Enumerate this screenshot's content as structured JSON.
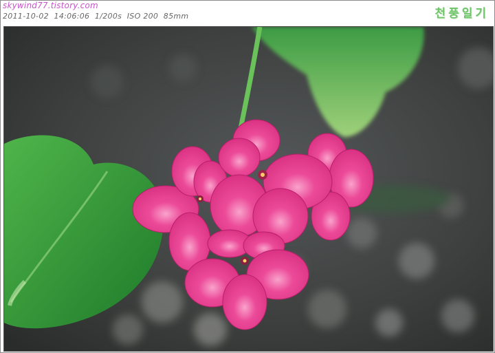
{
  "header": {
    "site_url": "skywind77.tistory.com",
    "exif_line": "2011-10-02  14:06:06  1/200s  ISO 200  85mm",
    "blog_title": "천풍일기"
  },
  "photo": {
    "subject": "pink-geranium-flower",
    "colors": {
      "petal": "#e8398f",
      "petal_dark": "#c01f6e",
      "petal_light": "#f57ab4",
      "leaf": "#2f9a3a",
      "leaf_light": "#7cc65a",
      "background": "#3f4340"
    }
  }
}
